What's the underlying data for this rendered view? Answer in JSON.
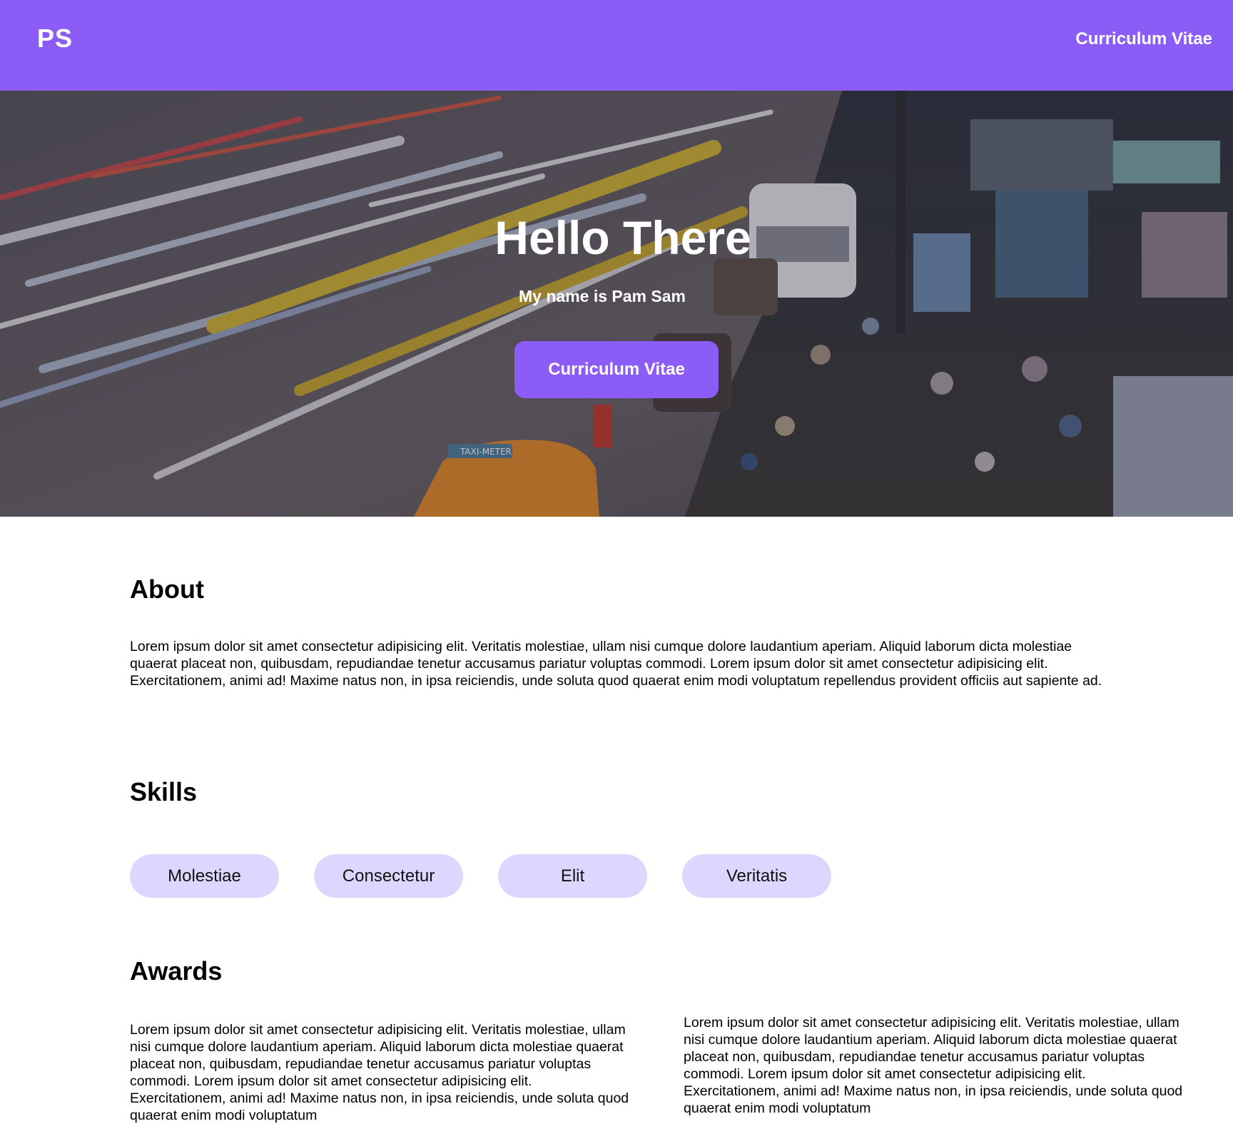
{
  "header": {
    "logo": "PS",
    "nav_link": "Curriculum Vitae",
    "background_color": "#8b5cf6"
  },
  "hero": {
    "title": "Hello There",
    "subtitle": "My name is Pam Sam",
    "button_label": "Curriculum Vitae",
    "background_image": "night-street-market-traffic-photo",
    "taxi_sign": "TAXI-METER"
  },
  "about": {
    "heading": "About",
    "text": "Lorem ipsum dolor sit amet consectetur adipisicing elit. Veritatis molestiae, ullam nisi cumque dolore laudantium aperiam. Aliquid laborum dicta molestiae quaerat placeat non, quibusdam, repudiandae tenetur accusamus pariatur voluptas commodi. Lorem ipsum dolor sit amet consectetur adipisicing elit. Exercitationem, animi ad! Maxime natus non, in ipsa reiciendis, unde soluta quod quaerat enim modi voluptatum repellendus provident officiis aut sapiente ad."
  },
  "skills": {
    "heading": "Skills",
    "items": [
      "Molestiae",
      "Consectetur",
      "Elit",
      "Veritatis"
    ],
    "pill_color": "#ddd6fe"
  },
  "awards": {
    "heading": "Awards",
    "items": [
      "Lorem ipsum dolor sit amet consectetur adipisicing elit. Veritatis molestiae, ullam nisi cumque dolore laudantium aperiam. Aliquid laborum dicta molestiae quaerat placeat non, quibusdam, repudiandae tenetur accusamus pariatur voluptas commodi. Lorem ipsum dolor sit amet consectetur adipisicing elit. Exercitationem, animi ad! Maxime natus non, in ipsa reiciendis, unde soluta quod quaerat enim modi voluptatum",
      "Lorem ipsum dolor sit amet consectetur adipisicing elit. Veritatis molestiae, ullam nisi cumque dolore laudantium aperiam. Aliquid laborum dicta molestiae quaerat placeat non, quibusdam, repudiandae tenetur accusamus pariatur voluptas commodi. Lorem ipsum dolor sit amet consectetur adipisicing elit. Exercitationem, animi ad! Maxime natus non, in ipsa reiciendis, unde soluta quod quaerat enim modi voluptatum"
    ]
  }
}
